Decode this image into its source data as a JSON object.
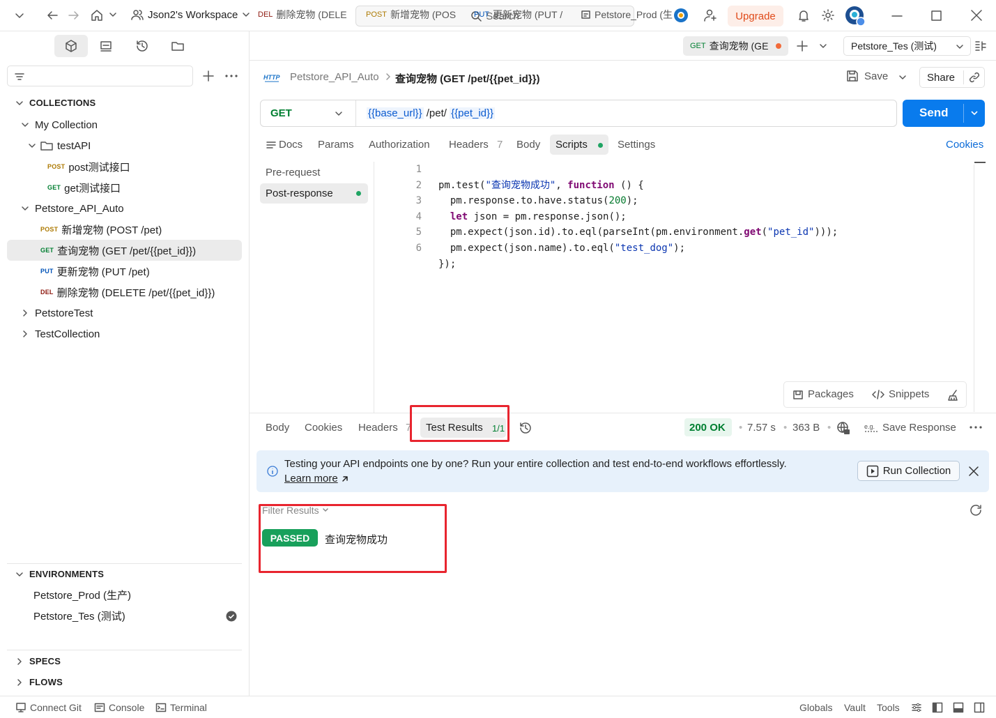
{
  "topbar": {
    "workspace": "Json2's Workspace",
    "search_placeholder": "Search",
    "upgrade_label": "Upgrade"
  },
  "sidebar": {
    "collections_header": "COLLECTIONS",
    "tree": {
      "my_collection": "My Collection",
      "testapi_folder": "testAPI",
      "testapi_post_method": "POST",
      "testapi_post": "post测试接口",
      "testapi_get_method": "GET",
      "testapi_get": "get测试接口",
      "petstore_auto": "Petstore_API_Auto",
      "req1_method": "POST",
      "req1": "新增宠物 (POST /pet)",
      "req2_method": "GET",
      "req2": "查询宠物 (GET /pet/{{pet_id}})",
      "req3_method": "PUT",
      "req3": "更新宠物 (PUT /pet)",
      "req4_method": "DEL",
      "req4": "删除宠物 (DELETE /pet/{{pet_id}})",
      "petstore_test": "PetstoreTest",
      "test_collection": "TestCollection"
    },
    "environments_header": "ENVIRONMENTS",
    "env_prod": "Petstore_Prod (生产)",
    "env_test": "Petstore_Tes (测试)",
    "specs_header": "SPECS",
    "flows_header": "FLOWS"
  },
  "tabs": [
    {
      "method": "DEL",
      "label": "删除宠物 (DELE"
    },
    {
      "method": "POST",
      "label": "新增宠物 (POS"
    },
    {
      "method": "PUT",
      "label": "更新宠物 (PUT /"
    },
    {
      "method": "",
      "label": "Petstore_Prod (生"
    },
    {
      "method": "GET",
      "label": "查询宠物 (GE"
    }
  ],
  "env_selector": "Petstore_Tes (测试)",
  "request": {
    "breadcrumb_parent": "Petstore_API_Auto",
    "title": "查询宠物 (GET /pet/{{pet_id}})",
    "save_label": "Save",
    "share_label": "Share",
    "method": "GET",
    "url_var1": "{{base_url}}",
    "url_path": " /pet/ ",
    "url_var2": "{{pet_id}}",
    "send_label": "Send"
  },
  "request_tabs": {
    "docs": "Docs",
    "params": "Params",
    "authorization": "Authorization",
    "headers": "Headers",
    "headers_count": "7",
    "body": "Body",
    "scripts": "Scripts",
    "settings": "Settings",
    "cookies": "Cookies"
  },
  "scripts": {
    "pre_request": "Pre-request",
    "post_response": "Post-response",
    "line_numbers": [
      "1",
      "2",
      "3",
      "4",
      "5",
      "6"
    ],
    "packages_label": "Packages",
    "snippets_label": "Snippets"
  },
  "code": {
    "l1a": "pm.test(",
    "l1b": "\"查询宠物成功\"",
    "l1c": ", ",
    "l1d": "function",
    "l1e": " () {",
    "l2a": "  pm.response.to.have.status(",
    "l2b": "200",
    "l2c": ");",
    "l3a": "  ",
    "l3b": "let",
    "l3c": " json = pm.response.json();",
    "l4a": "  pm.expect(json.id).to.eql(parseInt(pm.environment.",
    "l4b": "get",
    "l4c": "(",
    "l4d": "\"pet_id\"",
    "l4e": ")));",
    "l5a": "  pm.expect(json.name).to.eql(",
    "l5b": "\"test_dog\"",
    "l5c": ");",
    "l6": "});"
  },
  "response": {
    "body": "Body",
    "cookies": "Cookies",
    "headers": "Headers",
    "headers_count": "7",
    "test_results": "Test Results",
    "test_count": "1/1",
    "status": "200 OK",
    "time": "7.57 s",
    "size": "363 B",
    "save_response": "Save Response"
  },
  "banner": {
    "text": "Testing your API endpoints one by one? Run your entire collection and test end-to-end workflows effortlessly.",
    "learn_more": "Learn more",
    "run_collection": "Run Collection"
  },
  "results": {
    "filter": "Filter Results",
    "badge": "PASSED",
    "test_name": "查询宠物成功"
  },
  "bottombar": {
    "connect_git": "Connect Git",
    "console": "Console",
    "terminal": "Terminal",
    "globals": "Globals",
    "vault": "Vault",
    "tools": "Tools"
  },
  "colors": {
    "accent": "#097bed",
    "passed": "#18a05b",
    "status_ok": "#007f31",
    "upgrade": "#e04b1a",
    "highlight_box": "#e8252f"
  }
}
